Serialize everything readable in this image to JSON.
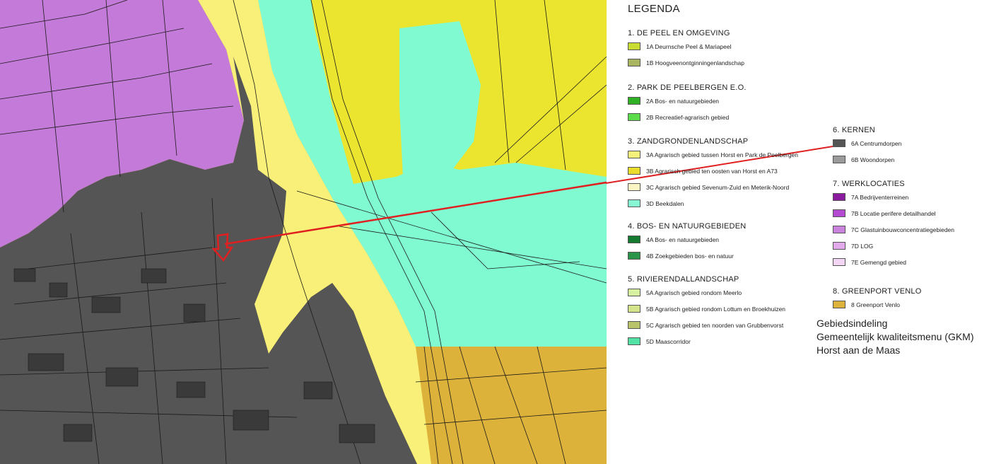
{
  "legend": {
    "title": "LEGENDA",
    "sections": [
      {
        "heading": "1. DE PEEL EN OMGEVING",
        "items": [
          {
            "label": "1A  Deurnsche Peel & Mariapeel",
            "color": "#c8dc34"
          },
          {
            "label": "1B  Hoogveenontginningenlandschap",
            "color": "#a9b561"
          }
        ]
      },
      {
        "heading": "2. PARK DE PEELBERGEN E.O.",
        "items": [
          {
            "label": "2A  Bos- en natuurgebieden",
            "color": "#2fb025"
          },
          {
            "label": "2B  Recreatief-agrarisch gebied",
            "color": "#5bdc4b"
          }
        ]
      },
      {
        "heading": "3. ZANDGRONDENLANDSCHAP",
        "items": [
          {
            "label": "3A  Agrarisch gebied tussen Horst en Park de Peelbergen",
            "color": "#f7f07a"
          },
          {
            "label": "3B  Agrarisch gebied ten oosten van Horst en A73",
            "color": "#e9dc2a"
          },
          {
            "label": "3C  Agrarisch gebied Sevenum-Zuid en Meterik-Noord",
            "color": "#fbf6c4"
          },
          {
            "label": "3D  Beekdalen",
            "color": "#86f7d2"
          }
        ]
      },
      {
        "heading": "4. BOS- EN NATUURGEBIEDEN",
        "items": [
          {
            "label": "4A  Bos- en natuurgebieden",
            "color": "#147a30"
          },
          {
            "label": "4B  Zoekgebieden bos- en natuur",
            "color": "#2a9448"
          }
        ]
      },
      {
        "heading": "5. RIVIERENDALLANDSCHAP",
        "items": [
          {
            "label": "5A  Agrarisch gebied rondom Meerlo",
            "color": "#d6f2a0"
          },
          {
            "label": "5B  Agrarisch gebied rondom Lottum en Broekhuizen",
            "color": "#d4e48a"
          },
          {
            "label": "5C  Agrarisch gebied ten noorden van Grubbenvorst",
            "color": "#b9c46a"
          },
          {
            "label": "5D  Maascorridor",
            "color": "#52e2a6"
          }
        ]
      },
      {
        "heading": "6. KERNEN",
        "items": [
          {
            "label": "6A  Centrumdorpen",
            "color": "#555555"
          },
          {
            "label": "6B  Woondorpen",
            "color": "#9a9a9a"
          }
        ]
      },
      {
        "heading": "7. WERKLOCATIES",
        "items": [
          {
            "label": "7A  Bedrijventerreinen",
            "color": "#8a1a9e"
          },
          {
            "label": "7B  Locatie perifere detailhandel",
            "color": "#b44ad2"
          },
          {
            "label": "7C  Glastuinbouwconcentratiegebieden",
            "color": "#c983dc"
          },
          {
            "label": "7D  LOG",
            "color": "#e3aaeb"
          },
          {
            "label": "7E  Gemengd gebied",
            "color": "#f2d6f4"
          }
        ]
      },
      {
        "heading": "8. GREENPORT VENLO",
        "items": [
          {
            "label": "8  Greenport Venlo",
            "color": "#dcb23a"
          }
        ]
      }
    ]
  },
  "caption": {
    "line1": "Gebiedsindeling",
    "line2": "Gemeentelijk kwaliteitsmenu (GKM)",
    "line3": "Horst aan de Maas"
  },
  "map": {
    "colors": {
      "kernen": "#555555",
      "werklocatie": "#c47ad8",
      "zandgrond": "#ebe530",
      "zandgrond_light": "#f8f078",
      "beekdal": "#80fbd1",
      "greenport": "#dcb23a",
      "marker": "#e02020"
    }
  }
}
